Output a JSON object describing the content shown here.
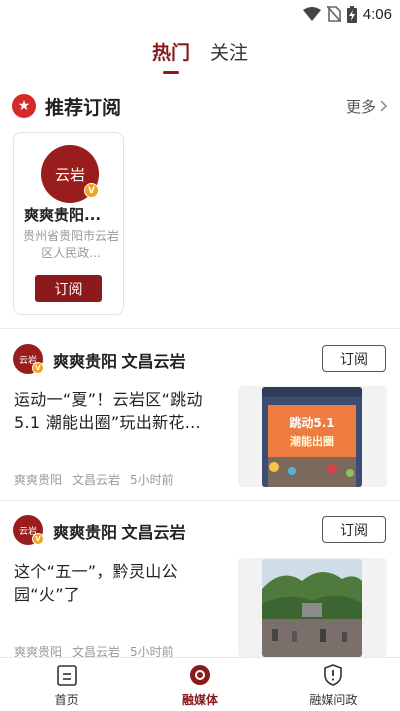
{
  "status_bar": {
    "time": "4:06"
  },
  "top_tabs": [
    {
      "label": "热门",
      "active": true
    },
    {
      "label": "关注",
      "active": false
    }
  ],
  "recommend": {
    "title": "推荐订阅",
    "more_label": "更多",
    "cards": [
      {
        "name": "爽爽贵阳...",
        "avatar_text": "云岩",
        "description": "贵州省贵阳市云岩区人民政...",
        "subscribe_label": "订阅"
      }
    ]
  },
  "feed": [
    {
      "source": "爽爽贵阳 文昌云岩",
      "avatar_text": "云岩",
      "subscribe_label": "订阅",
      "headline": "运动一“夏”！云岩区“跳动5.1 潮能出圈”玩出新花...",
      "meta": [
        "爽爽贵阳",
        "文昌云岩",
        "5小时前"
      ],
      "thumb_text_1": "跳动5.1",
      "thumb_text_2": "潮能出圈"
    },
    {
      "source": "爽爽贵阳 文昌云岩",
      "avatar_text": "云岩",
      "subscribe_label": "订阅",
      "headline": "这个“五一”，黔灵山公园“火”了",
      "meta": [
        "爽爽贵阳",
        "文昌云岩",
        "5小时前"
      ]
    }
  ],
  "bottom_nav": [
    {
      "label": "首页",
      "icon": "home-doc-icon",
      "active": false
    },
    {
      "label": "融媒体",
      "icon": "media-circle-icon",
      "active": true
    },
    {
      "label": "融媒问政",
      "icon": "shield-alert-icon",
      "active": false
    }
  ],
  "colors": {
    "brand": "#8c1a1a",
    "badge": "#d62a2a",
    "vip": "#f0a417"
  }
}
